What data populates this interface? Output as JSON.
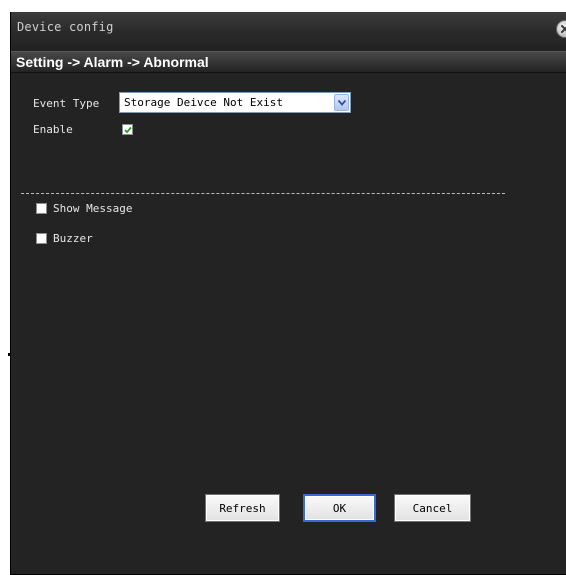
{
  "window": {
    "title": "Device config"
  },
  "breadcrumb": "Setting -> Alarm -> Abnormal",
  "form": {
    "event_type_label": "Event Type",
    "event_type_value": "Storage Deivce Not Exist",
    "enable_label": "Enable",
    "enable_checked": true,
    "show_message_label": "Show Message",
    "show_message_checked": false,
    "buzzer_label": "Buzzer",
    "buzzer_checked": false
  },
  "buttons": {
    "refresh": "Refresh",
    "ok": "OK",
    "cancel": "Cancel"
  },
  "colors": {
    "background": "#232323",
    "titlebar": "#2a2a2a",
    "text": "#e6e6e6",
    "check": "#2e9a2e"
  },
  "icons": {
    "close": "close-icon",
    "dropdown": "chevron-down-icon",
    "check": "checkmark-icon"
  }
}
